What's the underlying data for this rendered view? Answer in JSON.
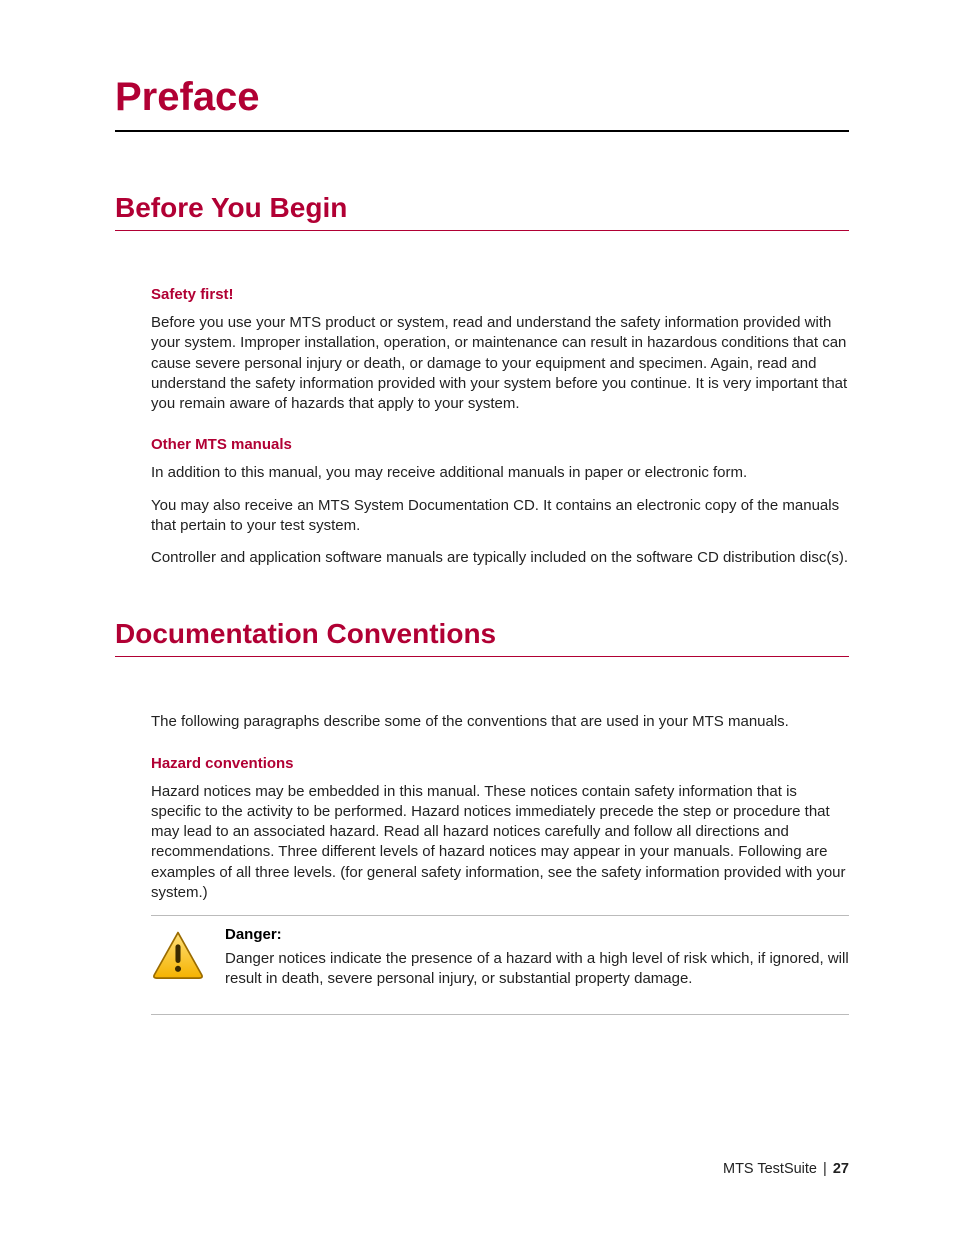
{
  "title": "Preface",
  "section1": {
    "heading": "Before You Begin",
    "sub1": {
      "heading": "Safety first!",
      "p1": "Before you use your MTS product or system, read and understand the safety information provided with your system. Improper installation, operation, or maintenance can result in hazardous conditions that can cause severe personal injury or death, or damage to your equipment and specimen. Again, read and understand the safety information provided with your system before you continue. It is very important that you remain aware of hazards that apply to your system."
    },
    "sub2": {
      "heading": "Other MTS manuals",
      "p1": "In addition to this manual, you may receive additional manuals in paper or electronic form.",
      "p2": "You may also receive an MTS System Documentation CD. It contains an electronic copy of the manuals that pertain to your test system.",
      "p3": "Controller and application software manuals are typically included on the software CD distribution disc(s)."
    }
  },
  "section2": {
    "heading": "Documentation Conventions",
    "intro": "The following paragraphs describe some of the conventions that are used in your MTS manuals.",
    "sub1": {
      "heading": "Hazard conventions",
      "p1": "Hazard notices may be embedded in this manual. These notices contain safety information that is specific to the activity to be performed. Hazard notices immediately precede the step or procedure that may lead to an associated hazard. Read all hazard notices carefully and follow all directions and recommendations. Three different levels of hazard notices may appear in your manuals. Following are examples of all three levels. (for general safety information, see the safety information provided with your system.)"
    },
    "danger": {
      "label": "Danger:",
      "text": "Danger notices indicate the presence of a hazard with a high level of risk which, if ignored, will result in death, severe personal injury, or substantial property damage."
    }
  },
  "footer": {
    "product": "MTS TestSuite",
    "sep": "|",
    "page": "27"
  }
}
